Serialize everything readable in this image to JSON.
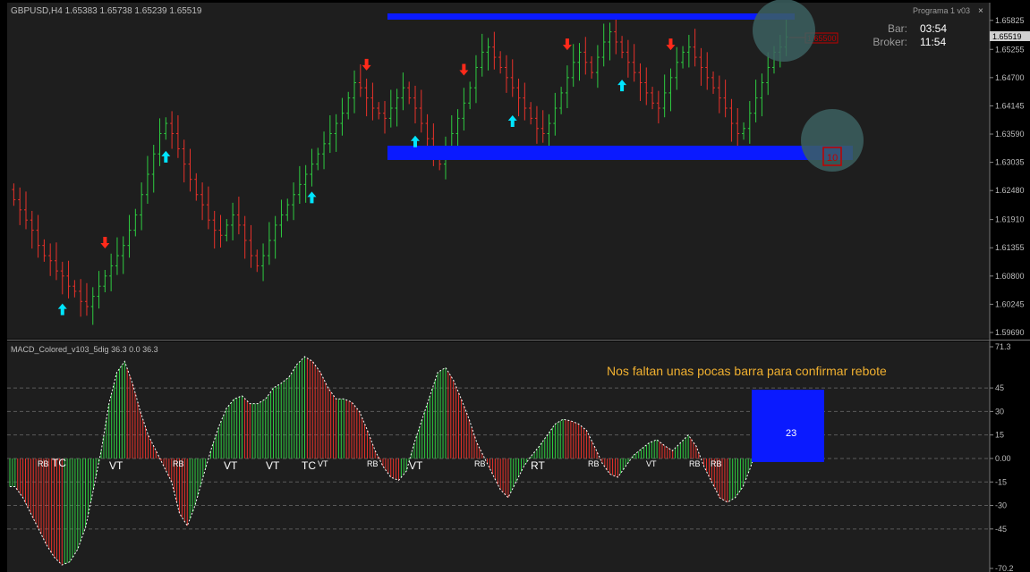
{
  "window": {
    "title": "Programa 1  v03",
    "close_label": "×",
    "main_header": "GBPUSD,H4  1.65383 1.65738 1.65239 1.65519",
    "indicator_header": "MACD_Colored_v103_5dig 36.3 0.0 36.3"
  },
  "info_panel": {
    "bar_label": "Bar:",
    "bar_value": "03:54",
    "broker_label": "Broker:",
    "broker_value": "11:54"
  },
  "annotation": "Nos faltan unas pocas barra para confirmar rebote",
  "current_price_label": "1.65519",
  "alert_price_label": "1.65500",
  "alert_box_value": "10",
  "histogram_value_label": "23",
  "colors": {
    "background": "#000000",
    "panel_bg": "#1e1e1e",
    "grid": "#5a5a5a",
    "bull": "#2ecc40",
    "bear": "#e8312a",
    "up_arrow": "#00e5ff",
    "down_arrow": "#ff2a1a",
    "zone": "#0a1aff",
    "circle": "#3c6060",
    "annotation": "#f0b030",
    "text": "#bcbcbc",
    "macd_line": "#ffffff"
  },
  "price_axis": {
    "ticks": [
      "1.65825",
      "1.65255",
      "1.64700",
      "1.64145",
      "1.63590",
      "1.63035",
      "1.62480",
      "1.61910",
      "1.61355",
      "1.60800",
      "1.60245",
      "1.59690"
    ]
  },
  "macd_axis": {
    "ticks": [
      "71.3",
      "45",
      "30",
      "15",
      "0.00",
      "-15",
      "-30",
      "-45",
      "-70.2"
    ]
  },
  "chart_data": [
    {
      "type": "candlestick",
      "symbol": "GBPUSD",
      "timeframe": "H4",
      "ylim": [
        1.5969,
        1.6605
      ],
      "ohlc": [
        1.65383,
        1.65738,
        1.65239,
        1.65519
      ],
      "close_series": [
        1.623,
        1.621,
        1.619,
        1.617,
        1.614,
        1.612,
        1.611,
        1.609,
        1.608,
        1.606,
        1.605,
        1.603,
        1.602,
        1.604,
        1.606,
        1.608,
        1.61,
        1.612,
        1.614,
        1.617,
        1.62,
        1.624,
        1.628,
        1.632,
        1.636,
        1.638,
        1.636,
        1.633,
        1.63,
        1.627,
        1.624,
        1.622,
        1.619,
        1.617,
        1.616,
        1.618,
        1.62,
        1.618,
        1.615,
        1.612,
        1.61,
        1.612,
        1.615,
        1.618,
        1.62,
        1.622,
        1.624,
        1.626,
        1.628,
        1.63,
        1.632,
        1.634,
        1.636,
        1.638,
        1.64,
        1.643,
        1.646,
        1.645,
        1.643,
        1.641,
        1.64,
        1.639,
        1.641,
        1.643,
        1.645,
        1.643,
        1.641,
        1.638,
        1.635,
        1.632,
        1.63,
        1.633,
        1.636,
        1.639,
        1.642,
        1.645,
        1.649,
        1.652,
        1.653,
        1.651,
        1.649,
        1.647,
        1.645,
        1.643,
        1.641,
        1.639,
        1.637,
        1.636,
        1.638,
        1.641,
        1.644,
        1.647,
        1.65,
        1.652,
        1.65,
        1.648,
        1.651,
        1.654,
        1.656,
        1.654,
        1.652,
        1.65,
        1.648,
        1.646,
        1.644,
        1.642,
        1.641,
        1.644,
        1.647,
        1.65,
        1.652,
        1.653,
        1.651,
        1.649,
        1.647,
        1.645,
        1.643,
        1.641,
        1.638,
        1.636,
        1.637,
        1.64,
        1.643,
        1.646,
        1.649,
        1.652,
        1.653,
        1.655
      ],
      "up_arrows_at": [
        8,
        25,
        49,
        66,
        82,
        100
      ],
      "down_arrows_at": [
        15,
        58,
        74,
        91,
        108
      ],
      "zones": [
        {
          "name": "resistance",
          "from": 1.657,
          "to": 1.658
        },
        {
          "name": "support",
          "from": 1.6322,
          "to": 1.6345
        }
      ],
      "price_alert": 1.655
    },
    {
      "type": "bar",
      "title": "MACD_Colored_v103_5dig 36.3 0.0 36.3",
      "ylim": [
        -70.2,
        71.3
      ],
      "histogram": [
        -18,
        -25,
        -35,
        -45,
        -55,
        -63,
        -68,
        -66,
        -58,
        -44,
        -20,
        5,
        35,
        55,
        62,
        48,
        30,
        15,
        5,
        -5,
        -15,
        -35,
        -43,
        -30,
        -12,
        5,
        20,
        32,
        38,
        40,
        35,
        35,
        38,
        45,
        48,
        52,
        60,
        65,
        62,
        55,
        45,
        38,
        38,
        36,
        30,
        18,
        5,
        -5,
        -12,
        -14,
        -8,
        10,
        25,
        40,
        55,
        58,
        50,
        38,
        25,
        10,
        0,
        -10,
        -20,
        -25,
        -15,
        -5,
        2,
        8,
        15,
        22,
        25,
        24,
        22,
        18,
        8,
        -3,
        -10,
        -12,
        -5,
        2,
        6,
        10,
        12,
        8,
        5,
        10,
        15,
        8,
        -5,
        -15,
        -25,
        -28,
        -25,
        -18,
        -5,
        10,
        22,
        30,
        35
      ],
      "labels": [
        "RB",
        "TC",
        "VT",
        "RB",
        "VT",
        "VT",
        "TC",
        "VT",
        "RB",
        "VT",
        "RB",
        "RT",
        "RB",
        "VT",
        "RB",
        "RB"
      ],
      "current_value": 23,
      "levels": [
        45,
        30,
        15,
        0,
        -15,
        -30,
        -45
      ]
    }
  ]
}
